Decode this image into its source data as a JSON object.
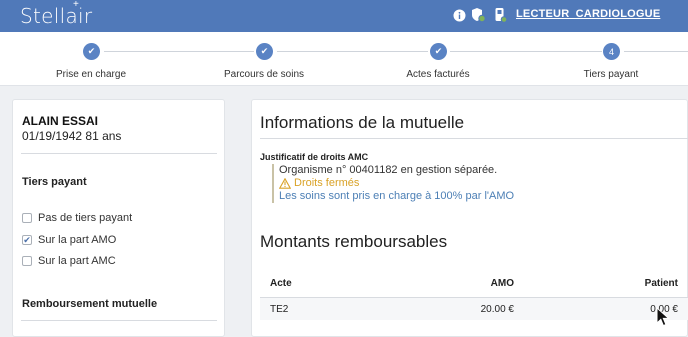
{
  "header": {
    "logo": "Stellair",
    "user": "LECTEUR_CARDIOLOGUE",
    "icons": [
      "info-icon",
      "shield-icon",
      "card-reader-icon"
    ]
  },
  "stepper": {
    "steps": [
      {
        "label": "Prise en charge",
        "state": "done",
        "mark": "✔"
      },
      {
        "label": "Parcours de soins",
        "state": "done",
        "mark": "✔"
      },
      {
        "label": "Actes facturés",
        "state": "done",
        "mark": "✔"
      },
      {
        "label": "Tiers payant",
        "state": "current",
        "mark": "4"
      }
    ]
  },
  "patient": {
    "name": "ALAIN ESSAI",
    "dob_age": "01/19/1942 81 ans"
  },
  "tiers_payant": {
    "title": "Tiers payant",
    "options": [
      {
        "label": "Pas de tiers payant",
        "checked": false
      },
      {
        "label": "Sur la part AMO",
        "checked": true
      },
      {
        "label": "Sur la part AMC",
        "checked": false
      }
    ]
  },
  "remboursement": {
    "title": "Remboursement mutuelle"
  },
  "mutuelle": {
    "title": "Informations de la mutuelle",
    "justificatif_label": "Justificatif de droits AMC",
    "organisme": "Organisme n° 00401182 en gestion séparée.",
    "droits": "Droits fermés",
    "soins": "Les soins sont pris en charge à 100% par l'AMO"
  },
  "montants": {
    "title": "Montants remboursables",
    "headers": {
      "acte": "Acte",
      "amo": "AMO",
      "patient": "Patient"
    },
    "rows": [
      {
        "acte": "TE2",
        "amo": "20.00 €",
        "patient": "0.00 €"
      }
    ]
  },
  "colors": {
    "header_bg": "#5079b9",
    "step_circle": "#5a83c4",
    "warning": "#d9a227",
    "link": "#4c7fb5"
  }
}
